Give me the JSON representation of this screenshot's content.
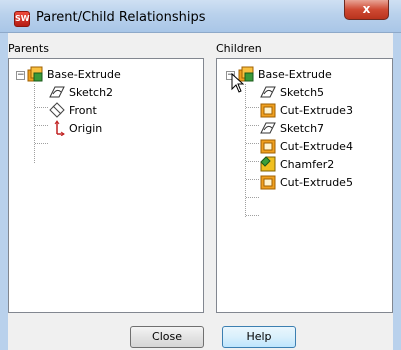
{
  "window": {
    "title": "Parent/Child Relationships",
    "close_glyph": "x",
    "app_icon": "solidworks-icon"
  },
  "parents": {
    "header": "Parents",
    "root": {
      "label": "Base-Extrude",
      "icon": "extrude-feature-icon"
    },
    "items": [
      {
        "label": "Sketch2",
        "icon": "sketch-icon"
      },
      {
        "label": "Front",
        "icon": "plane-icon"
      },
      {
        "label": "Origin",
        "icon": "origin-icon"
      }
    ]
  },
  "children": {
    "header": "Children",
    "root": {
      "label": "Base-Extrude",
      "icon": "extrude-feature-icon"
    },
    "items": [
      {
        "label": "Sketch5",
        "icon": "sketch-icon"
      },
      {
        "label": "Cut-Extrude3",
        "icon": "cut-extrude-icon"
      },
      {
        "label": "Sketch7",
        "icon": "sketch-icon"
      },
      {
        "label": "Cut-Extrude4",
        "icon": "cut-extrude-icon"
      },
      {
        "label": "Chamfer2",
        "icon": "chamfer-icon"
      },
      {
        "label": "Cut-Extrude5",
        "icon": "cut-extrude-icon"
      }
    ]
  },
  "buttons": {
    "close": "Close",
    "help": "Help"
  },
  "colors": {
    "titlebar": "#b9d1ec",
    "close_button": "#cf4a33",
    "dialog_bg": "#f0f0f0",
    "extrude_orange": "#f0a020"
  }
}
